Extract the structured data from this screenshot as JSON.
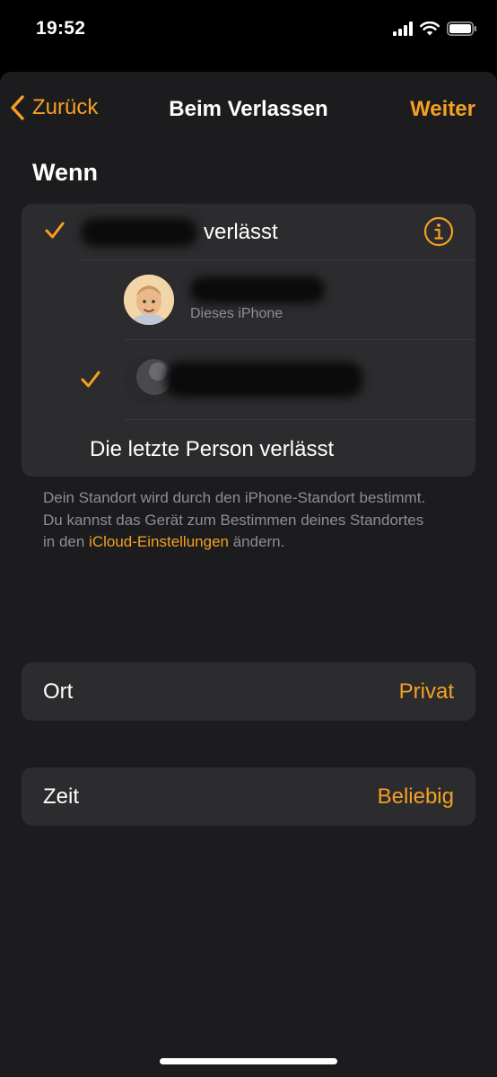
{
  "status_bar": {
    "time": "19:52",
    "icons": [
      "cellular-signal-icon",
      "wifi-icon",
      "battery-icon"
    ]
  },
  "nav": {
    "back_label": "Zurück",
    "title": "Beim Verlassen",
    "next_label": "Weiter"
  },
  "section": {
    "title": "Wenn"
  },
  "when_options": {
    "first": {
      "suffix": "verlässt",
      "checked": true
    },
    "person_1": {
      "subtitle": "Dieses iPhone",
      "checked": false
    },
    "person_2": {
      "checked": true
    },
    "last": {
      "label": "Die letzte Person verlässt",
      "checked": false
    }
  },
  "footnote": {
    "text": "Dein Standort wird durch den iPhone-Standort bestimmt. Du kannst das Gerät zum Bestimmen deines Standortes in den ",
    "link": "iCloud-Einstellungen",
    "text_end": " ändern."
  },
  "location": {
    "label": "Ort",
    "value": "Privat"
  },
  "time": {
    "label": "Zeit",
    "value": "Beliebig"
  },
  "colors": {
    "accent": "#f4a023",
    "background": "#000000",
    "sheet": "#1c1c1e",
    "card": "#2c2c2e",
    "secondary_text": "#8e8e93"
  }
}
